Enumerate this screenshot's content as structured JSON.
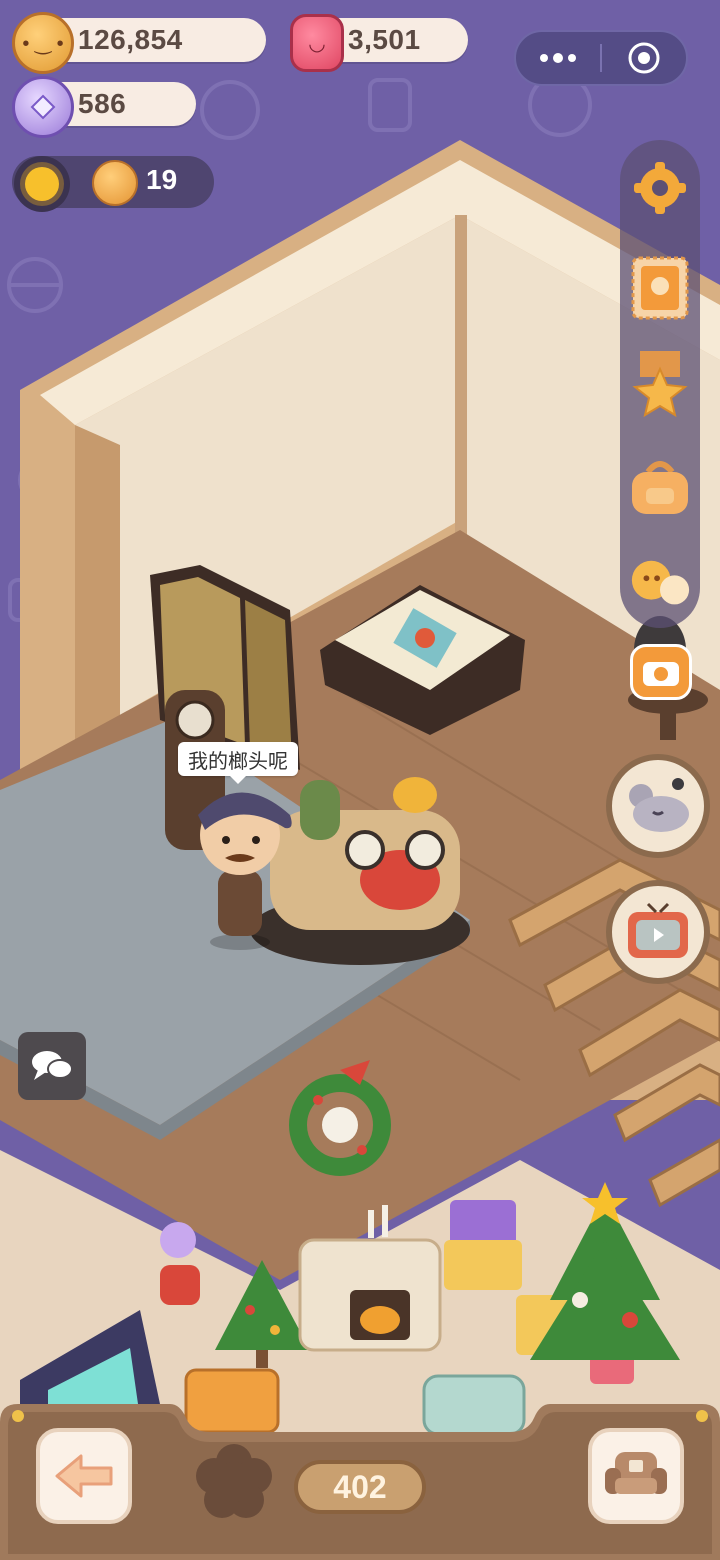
{
  "hud": {
    "coins": "126,854",
    "gems": "3,501",
    "candies": "586",
    "helpers": "19"
  },
  "speech": {
    "text": "我的榔头呢"
  },
  "bottom": {
    "counter": "402"
  },
  "icons": {
    "menu": "more-dots-icon",
    "close": "target-circle-icon",
    "settings": "gear-icon",
    "stamp": "stamp-card-icon",
    "medal": "star-medal-icon",
    "bag": "backpack-icon",
    "friends": "friends-icon",
    "camera": "camera-icon",
    "mouse": "sleeping-mouse-icon",
    "tv": "tv-video-icon",
    "chat": "chat-bubbles-icon",
    "back": "back-arrow-icon",
    "furniture": "armchair-icon"
  },
  "colors": {
    "background": "#6f60a6",
    "wall": "#efe1cc",
    "floor": "#a67b5b",
    "accent_gold": "#e49433"
  }
}
